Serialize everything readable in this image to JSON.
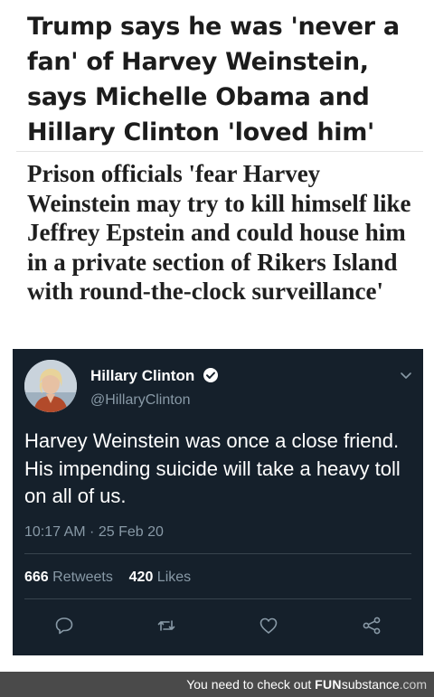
{
  "headline_top": "Trump says he was 'never a fan' of Harvey Weinstein, says Michelle Obama and Hillary Clinton 'loved him'",
  "headline_bottom": "Prison officials 'fear Harvey Weinstein may try to kill himself like Jeffrey Epstein and could house him in a private section of Rikers Island with round-the-clock surveillance'",
  "tweet": {
    "display_name": "Hillary Clinton",
    "handle": "@HillaryClinton",
    "text": "Harvey Weinstein was once a close friend. His impending suicide will take a heavy toll on all of us.",
    "timestamp": "10:17 AM · 25 Feb 20",
    "retweets_count": "666",
    "retweets_label": "Retweets",
    "likes_count": "420",
    "likes_label": "Likes",
    "icons": {
      "verified": "verified-badge-icon",
      "menu": "chevron-down-icon",
      "reply": "reply-icon",
      "retweet": "retweet-icon",
      "like": "heart-icon",
      "share": "share-icon"
    },
    "colors": {
      "background": "#15202b",
      "secondary_text": "#8899a6",
      "verified": "#1da1f2"
    }
  },
  "footer": {
    "prefix": "You need to check out",
    "brand_fun": "FUN",
    "brand_substance": "substance",
    "brand_tld": ".com",
    "background": "#4a4a4a"
  }
}
